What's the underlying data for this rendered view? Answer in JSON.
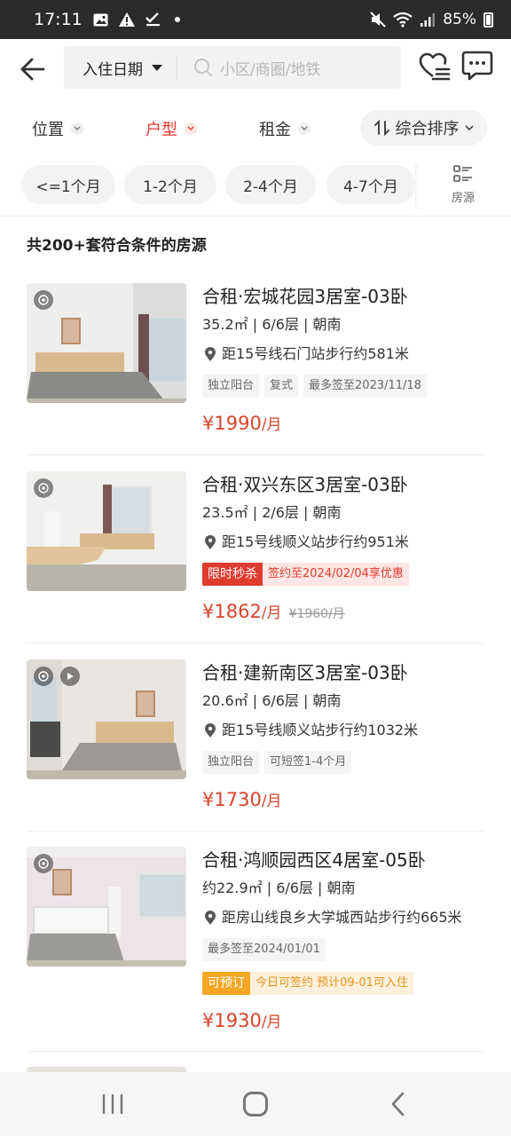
{
  "status_bar": {
    "time": "17:11",
    "battery": "85%",
    "icons": [
      "image-icon",
      "warning-icon",
      "check-icon",
      "dot-icon",
      "mute-icon",
      "wifi-icon",
      "signal-icon",
      "battery-icon"
    ]
  },
  "header": {
    "date_filter": "入住日期",
    "search_placeholder": "小区/商圈/地铁"
  },
  "filters": {
    "location": "位置",
    "room_type": "户型",
    "rent": "租金",
    "sort": "综合排序"
  },
  "colors": {
    "accent": "#e5382f",
    "price": "#d9442b",
    "promo_red": "#e03b2f",
    "promo_orange": "#f5a623"
  },
  "chips": [
    "<=1个月",
    "1-2个月",
    "2-4个月",
    "4-7个月"
  ],
  "source_label": "房源",
  "result_count": "共200+套符合条件的房源",
  "listings": [
    {
      "title": "合租·宏城花园3居室-03卧",
      "meta": "35.2㎡ | 6/6层 | 朝南",
      "location": "距15号线石门站步行约581米",
      "tags": [
        "独立阳台",
        "复式",
        "最多签至2023/11/18"
      ],
      "price": "¥1990",
      "unit": "/月"
    },
    {
      "title": "合租·双兴东区3居室-03卧",
      "meta": "23.5㎡ | 2/6层 | 朝南",
      "location": "距15号线顺义站步行约951米",
      "promo_label": "限时秒杀",
      "promo_text": "签约至2024/02/04享优惠",
      "price": "¥1862",
      "unit": "/月",
      "old_price": "¥1960/月"
    },
    {
      "title": "合租·建新南区3居室-03卧",
      "meta": "20.6㎡ | 6/6层 | 朝南",
      "location": "距15号线顺义站步行约1032米",
      "tags": [
        "独立阳台",
        "可短签1-4个月"
      ],
      "price": "¥1730",
      "unit": "/月"
    },
    {
      "title": "合租·鸿顺园西区4居室-05卧",
      "meta": "约22.9㎡ | 6/6层 | 朝南",
      "location": "距房山线良乡大学城西站步行约665米",
      "tags": [
        "最多签至2024/01/01"
      ],
      "promo_label": "可预订",
      "promo_text": "今日可签约 预计09-01可入住",
      "price": "¥1930",
      "unit": "/月"
    }
  ]
}
